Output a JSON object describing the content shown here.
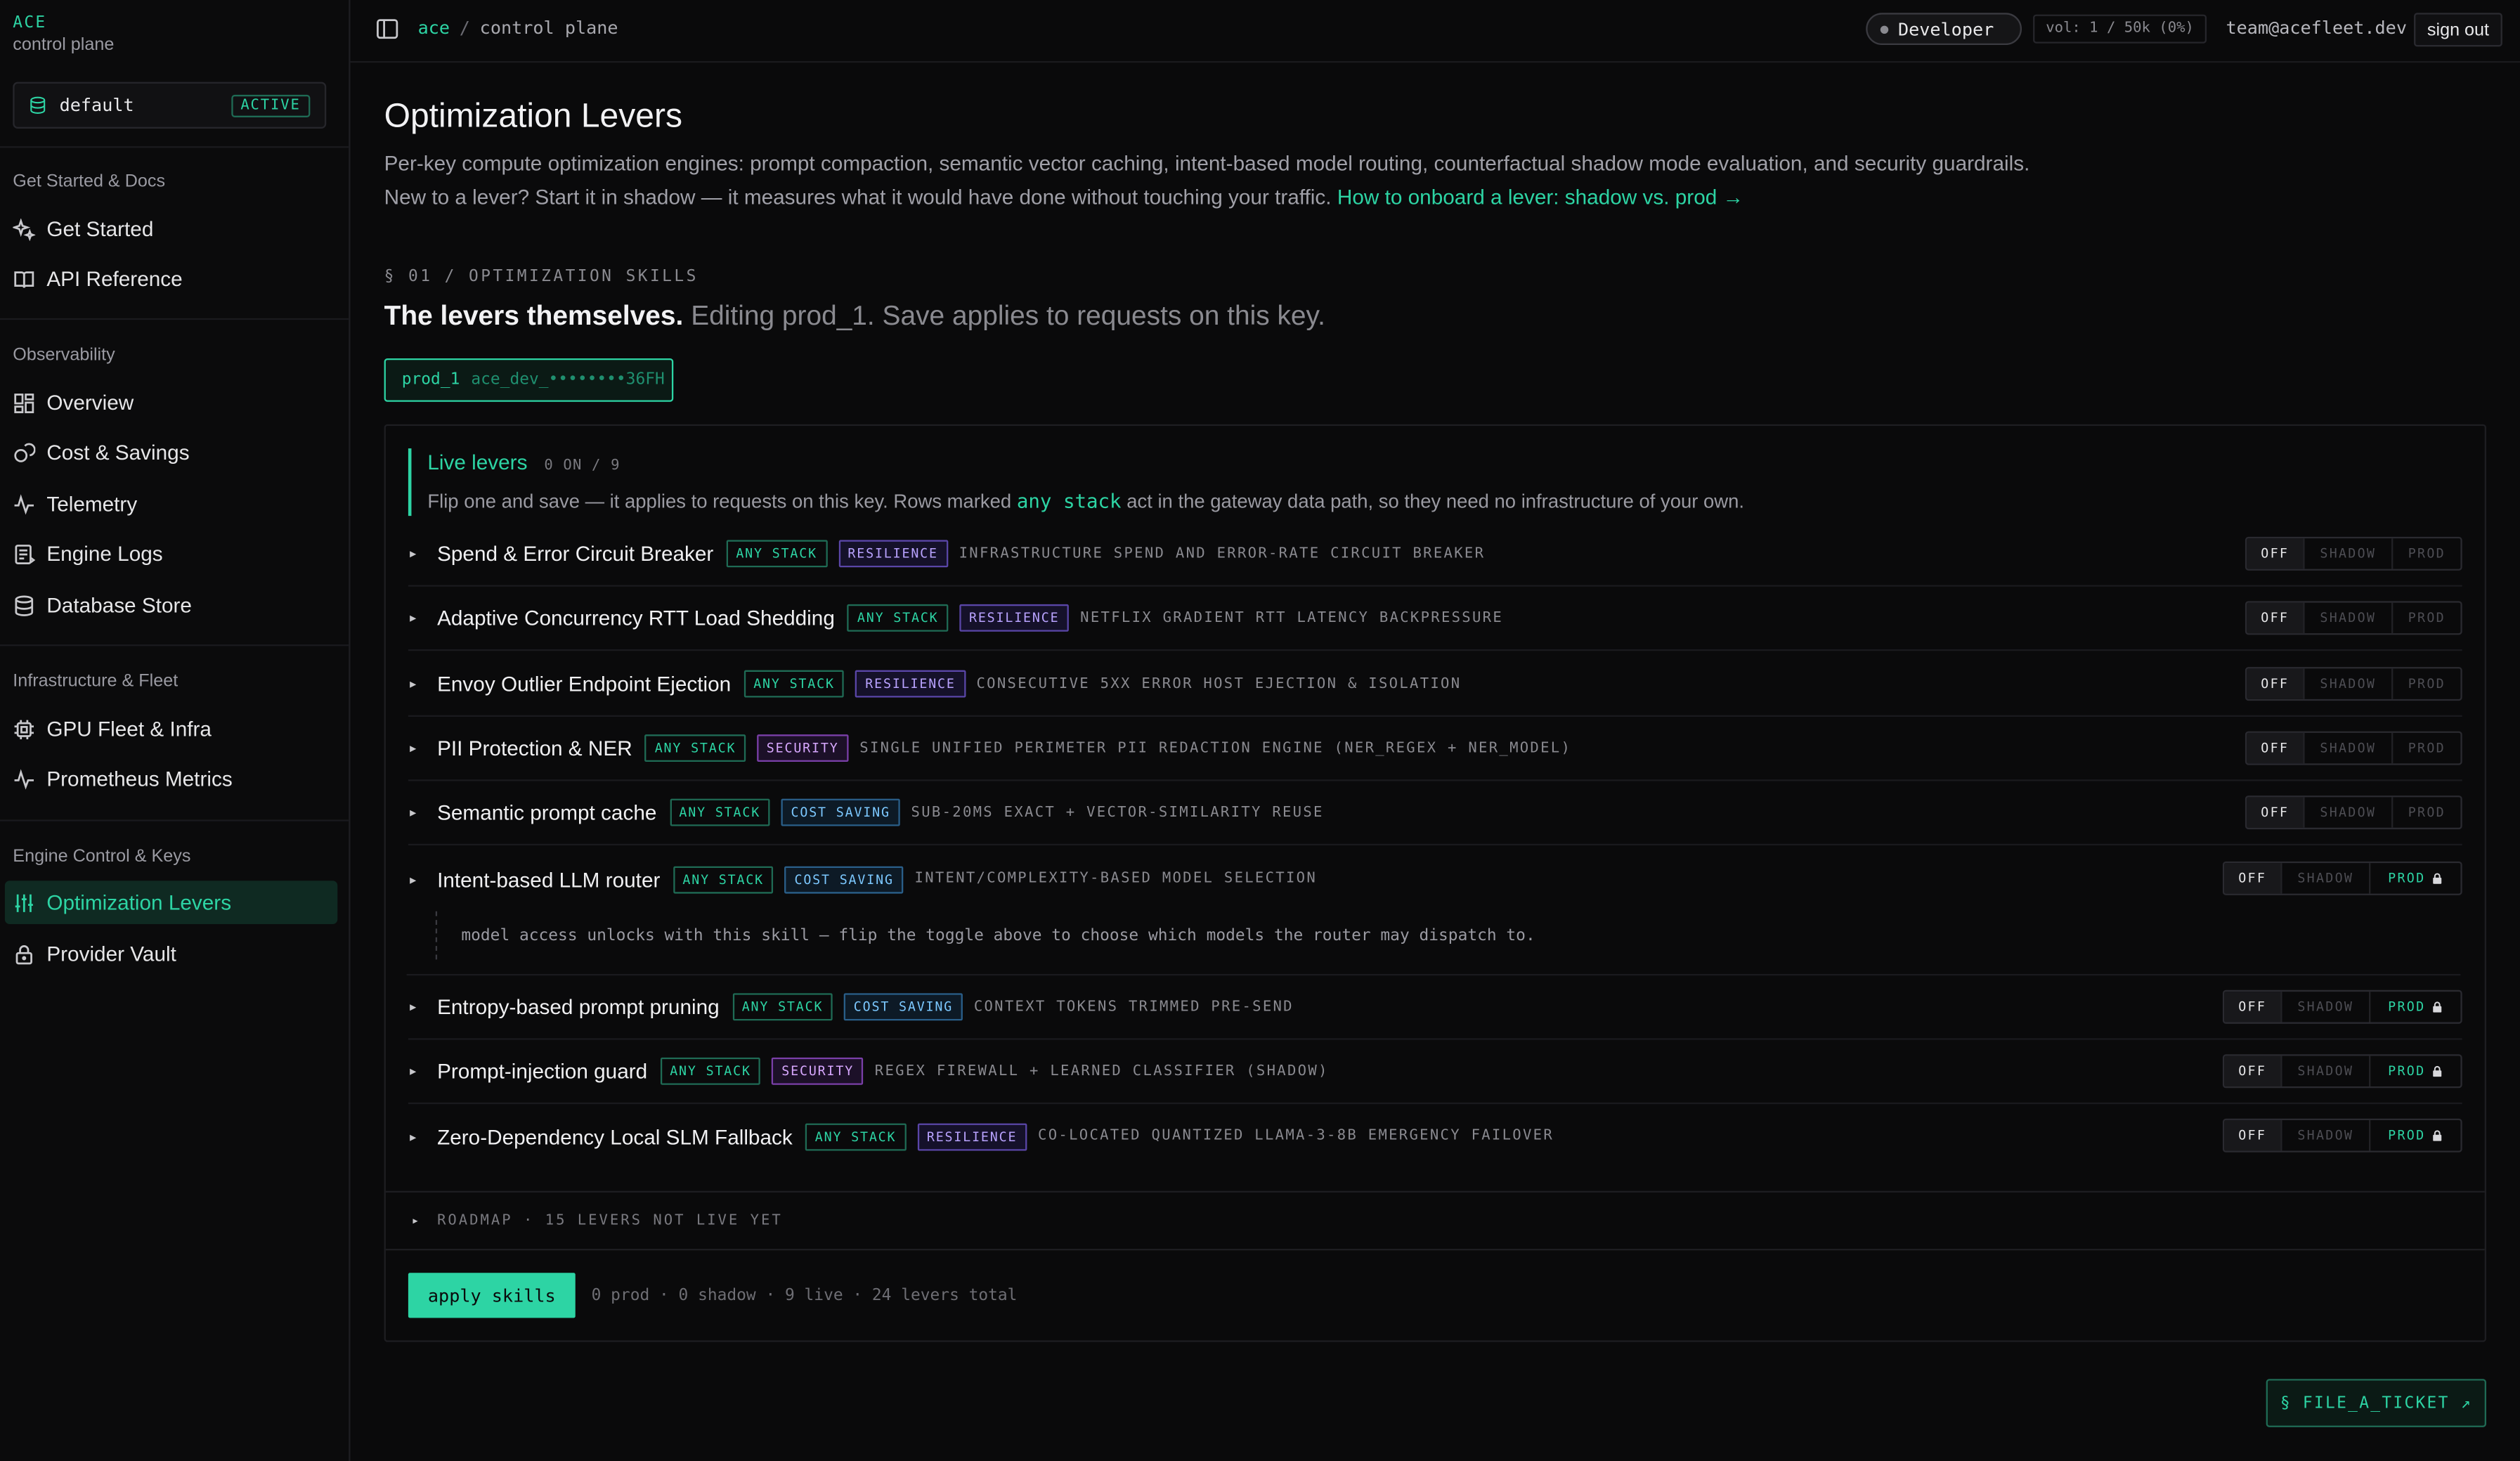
{
  "brand": {
    "name": "ACE",
    "subtitle": "control plane"
  },
  "workspace": {
    "name": "default",
    "badge": "ACTIVE"
  },
  "sidebar": {
    "sections": [
      {
        "title": "Get Started & Docs",
        "items": [
          {
            "label": "Get Started",
            "icon": "sparkle-icon"
          },
          {
            "label": "API Reference",
            "icon": "book-icon"
          }
        ]
      },
      {
        "title": "Observability",
        "items": [
          {
            "label": "Overview",
            "icon": "grid-icon"
          },
          {
            "label": "Cost & Savings",
            "icon": "coins-icon"
          },
          {
            "label": "Telemetry",
            "icon": "pulse-icon"
          },
          {
            "label": "Engine Logs",
            "icon": "logs-icon"
          },
          {
            "label": "Database Store",
            "icon": "database-icon"
          }
        ]
      },
      {
        "title": "Infrastructure & Fleet",
        "items": [
          {
            "label": "GPU Fleet & Infra",
            "icon": "chip-icon"
          },
          {
            "label": "Prometheus Metrics",
            "icon": "pulse-icon"
          }
        ]
      },
      {
        "title": "Engine Control & Keys",
        "items": [
          {
            "label": "Optimization Levers",
            "icon": "sliders-icon",
            "active": true
          },
          {
            "label": "Provider Vault",
            "icon": "lock-icon"
          }
        ]
      }
    ]
  },
  "topbar": {
    "breadcrumb": [
      "ace",
      "control plane"
    ],
    "plan": "Developer",
    "volume": "vol: 1 / 50k (0%)",
    "email": "team@acefleet.dev",
    "signout": "sign out"
  },
  "page": {
    "title": "Optimization Levers",
    "desc1": "Per-key compute optimization engines: prompt compaction, semantic vector caching, intent-based model routing, counterfactual shadow mode evaluation, and security guardrails.",
    "desc2": "New to a lever? Start it in shadow — it measures what it would have done without touching your traffic.",
    "desc2_link": "How to onboard a lever: shadow vs. prod →",
    "section_label": "§ 01 / OPTIMIZATION SKILLS",
    "section_head_bold": "The levers themselves.",
    "section_head_rest": "Editing prod_1. Save applies to requests on this key.",
    "key": {
      "name": "prod_1",
      "masked": "ace_dev_••••••••36FH"
    }
  },
  "levers": {
    "live_title": "Live levers",
    "live_count": "0 ON / 9",
    "live_desc_a": "Flip one and save — it applies to requests on this key. Rows marked",
    "live_desc_hl": "any stack",
    "live_desc_b": "act in the gateway data path, so they need no infrastructure of your own.",
    "toggle_labels": {
      "off": "OFF",
      "shadow": "SHADOW",
      "prod": "PROD"
    },
    "rows": [
      {
        "name": "Spend & Error Circuit Breaker",
        "stack": "ANY STACK",
        "category": "RESILIENCE",
        "desc": "INFRASTRUCTURE SPEND AND ERROR-RATE CIRCUIT BREAKER",
        "locked": false
      },
      {
        "name": "Adaptive Concurrency RTT Load Shedding",
        "stack": "ANY STACK",
        "category": "RESILIENCE",
        "desc": "NETFLIX GRADIENT RTT LATENCY BACKPRESSURE",
        "locked": false
      },
      {
        "name": "Envoy Outlier Endpoint Ejection",
        "stack": "ANY STACK",
        "category": "RESILIENCE",
        "desc": "CONSECUTIVE 5XX ERROR HOST EJECTION & ISOLATION",
        "locked": false
      },
      {
        "name": "PII Protection & NER",
        "stack": "ANY STACK",
        "category": "SECURITY",
        "desc": "SINGLE UNIFIED PERIMETER PII REDACTION ENGINE (NER_REGEX + NER_MODEL)",
        "locked": false
      },
      {
        "name": "Semantic prompt cache",
        "stack": "ANY STACK",
        "category": "COST SAVING",
        "desc": "SUB-20MS EXACT + VECTOR-SIMILARITY REUSE",
        "locked": false
      },
      {
        "name": "Intent-based LLM router",
        "stack": "ANY STACK",
        "category": "COST SAVING",
        "desc": "INTENT/COMPLEXITY-BASED MODEL SELECTION",
        "locked": true
      },
      {
        "name": "Entropy-based prompt pruning",
        "stack": "ANY STACK",
        "category": "COST SAVING",
        "desc": "CONTEXT TOKENS TRIMMED PRE-SEND",
        "locked": true
      },
      {
        "name": "Prompt-injection guard",
        "stack": "ANY STACK",
        "category": "SECURITY",
        "desc": "REGEX FIREWALL + LEARNED CLASSIFIER (SHADOW)",
        "locked": true
      },
      {
        "name": "Zero-Dependency Local SLM Fallback",
        "stack": "ANY STACK",
        "category": "RESILIENCE",
        "desc": "CO-LOCATED QUANTIZED LLAMA-3-8B EMERGENCY FAILOVER",
        "locked": true
      }
    ],
    "router_note": "model access unlocks with this skill — flip the toggle above to choose which models the router may dispatch to.",
    "roadmap": "ROADMAP · 15 LEVERS NOT LIVE YET",
    "apply_button": "apply skills",
    "apply_stats": "0 prod · 0 shadow · 9 live · 24 levers total"
  },
  "ticket_button": "§ FILE_A_TICKET ↗",
  "colors": {
    "accent": "#2dd4a4",
    "background": "#0a0a0b",
    "resilience": "#b9a3ff",
    "security": "#d8a8ff",
    "cost": "#7cc8ff"
  }
}
